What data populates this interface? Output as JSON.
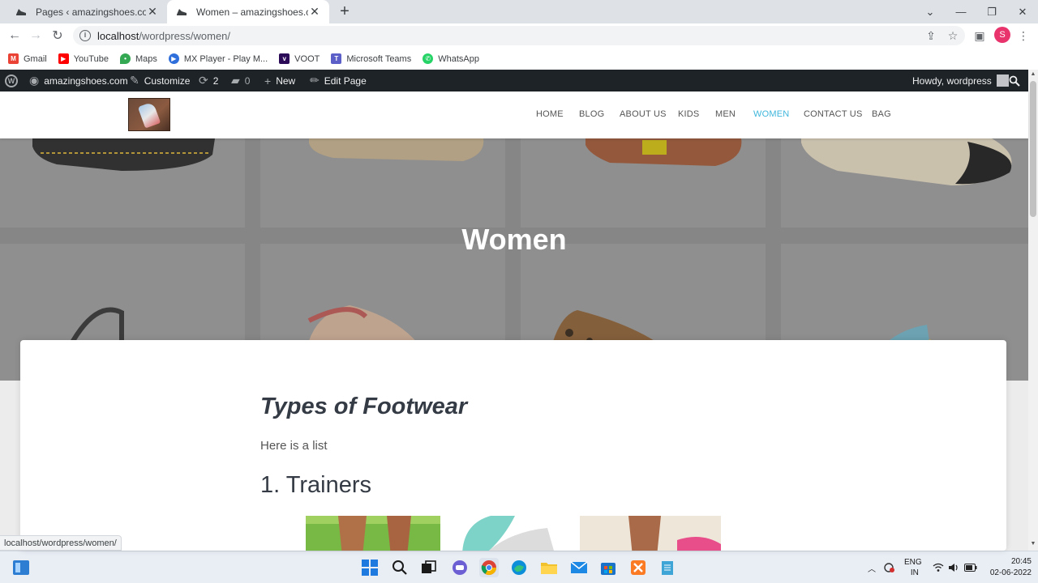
{
  "browser": {
    "tabs": [
      {
        "title": "Pages ‹ amazingshoes.com — W",
        "active": false
      },
      {
        "title": "Women – amazingshoes.com",
        "active": true
      }
    ],
    "address": {
      "host": "localhost",
      "path": "/wordpress/women/"
    },
    "profile_initial": "S",
    "bookmarks": [
      {
        "label": "Gmail",
        "icon": "gmail-icon",
        "color": "#ea4335"
      },
      {
        "label": "YouTube",
        "icon": "youtube-icon",
        "color": "#ff0000"
      },
      {
        "label": "Maps",
        "icon": "maps-icon",
        "color": "#34a853"
      },
      {
        "label": "MX Player - Play M...",
        "icon": "mxplayer-icon",
        "color": "#2f6fdb"
      },
      {
        "label": "VOOT",
        "icon": "voot-icon",
        "color": "#2b0a57"
      },
      {
        "label": "Microsoft Teams",
        "icon": "teams-icon",
        "color": "#5b5fc7"
      },
      {
        "label": "WhatsApp",
        "icon": "whatsapp-icon",
        "color": "#25d366"
      }
    ],
    "status_url": "localhost/wordpress/women/"
  },
  "adminbar": {
    "site": "amazingshoes.com",
    "customize": "Customize",
    "updates": "2",
    "comments": "0",
    "new": "New",
    "edit": "Edit Page",
    "howdy": "Howdy, wordpress"
  },
  "site": {
    "nav": [
      "HOME",
      "BLOG",
      "ABOUT US",
      "KIDS",
      "MEN",
      "WOMEN",
      "CONTACT US",
      "BAG"
    ],
    "current_nav": "WOMEN",
    "accent": "#3fb6dc"
  },
  "hero": {
    "title": "Women"
  },
  "content": {
    "heading": "Types of Footwear",
    "intro": "Here is a list",
    "list_heading": "1. Trainers"
  },
  "taskbar": {
    "language": "ENG",
    "region": "IN",
    "time": "20:45",
    "date": "02-06-2022"
  }
}
